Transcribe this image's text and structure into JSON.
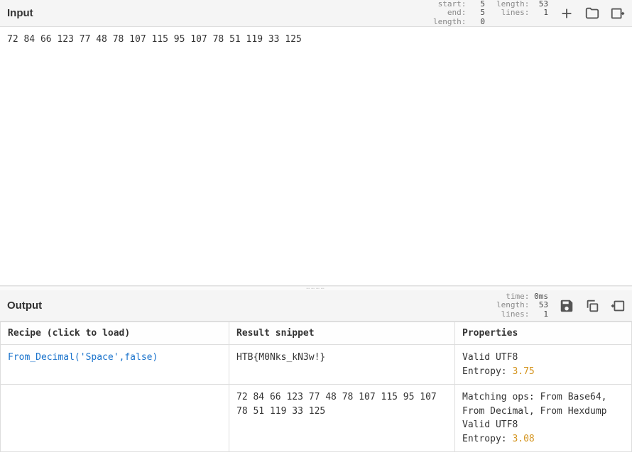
{
  "input": {
    "title": "Input",
    "text": "72 84 66 123 77 48 78 107 115 95 107 78 51 119 33 125",
    "stats_left": {
      "start": {
        "label": "start:",
        "value": "5"
      },
      "end": {
        "label": "end:",
        "value": "5"
      },
      "length": {
        "label": "length:",
        "value": "0"
      }
    },
    "stats_right": {
      "length": {
        "label": "length:",
        "value": "53"
      },
      "lines": {
        "label": "lines:",
        "value": "1"
      }
    }
  },
  "output": {
    "title": "Output",
    "stats": {
      "time": {
        "label": "time:",
        "value": "0ms"
      },
      "length": {
        "label": "length:",
        "value": "53"
      },
      "lines": {
        "label": "lines:",
        "value": "1"
      }
    },
    "columns": {
      "recipe": "Recipe (click to load)",
      "result": "Result snippet",
      "properties": "Properties"
    },
    "rows": [
      {
        "recipe": "From_Decimal('Space',false)",
        "result": "HTB{M0Nks_kN3w!}",
        "props_prefix": "Valid UTF8",
        "entropy_label": "Entropy: ",
        "entropy_value": "3.75"
      },
      {
        "recipe": "",
        "result": "72 84 66 123 77 48 78 107 115 95 107 78 51 119 33 125",
        "props_prefix": "Matching ops: From Base64, From Decimal, From Hexdump\nValid UTF8",
        "entropy_label": "Entropy: ",
        "entropy_value": "3.08"
      }
    ]
  }
}
